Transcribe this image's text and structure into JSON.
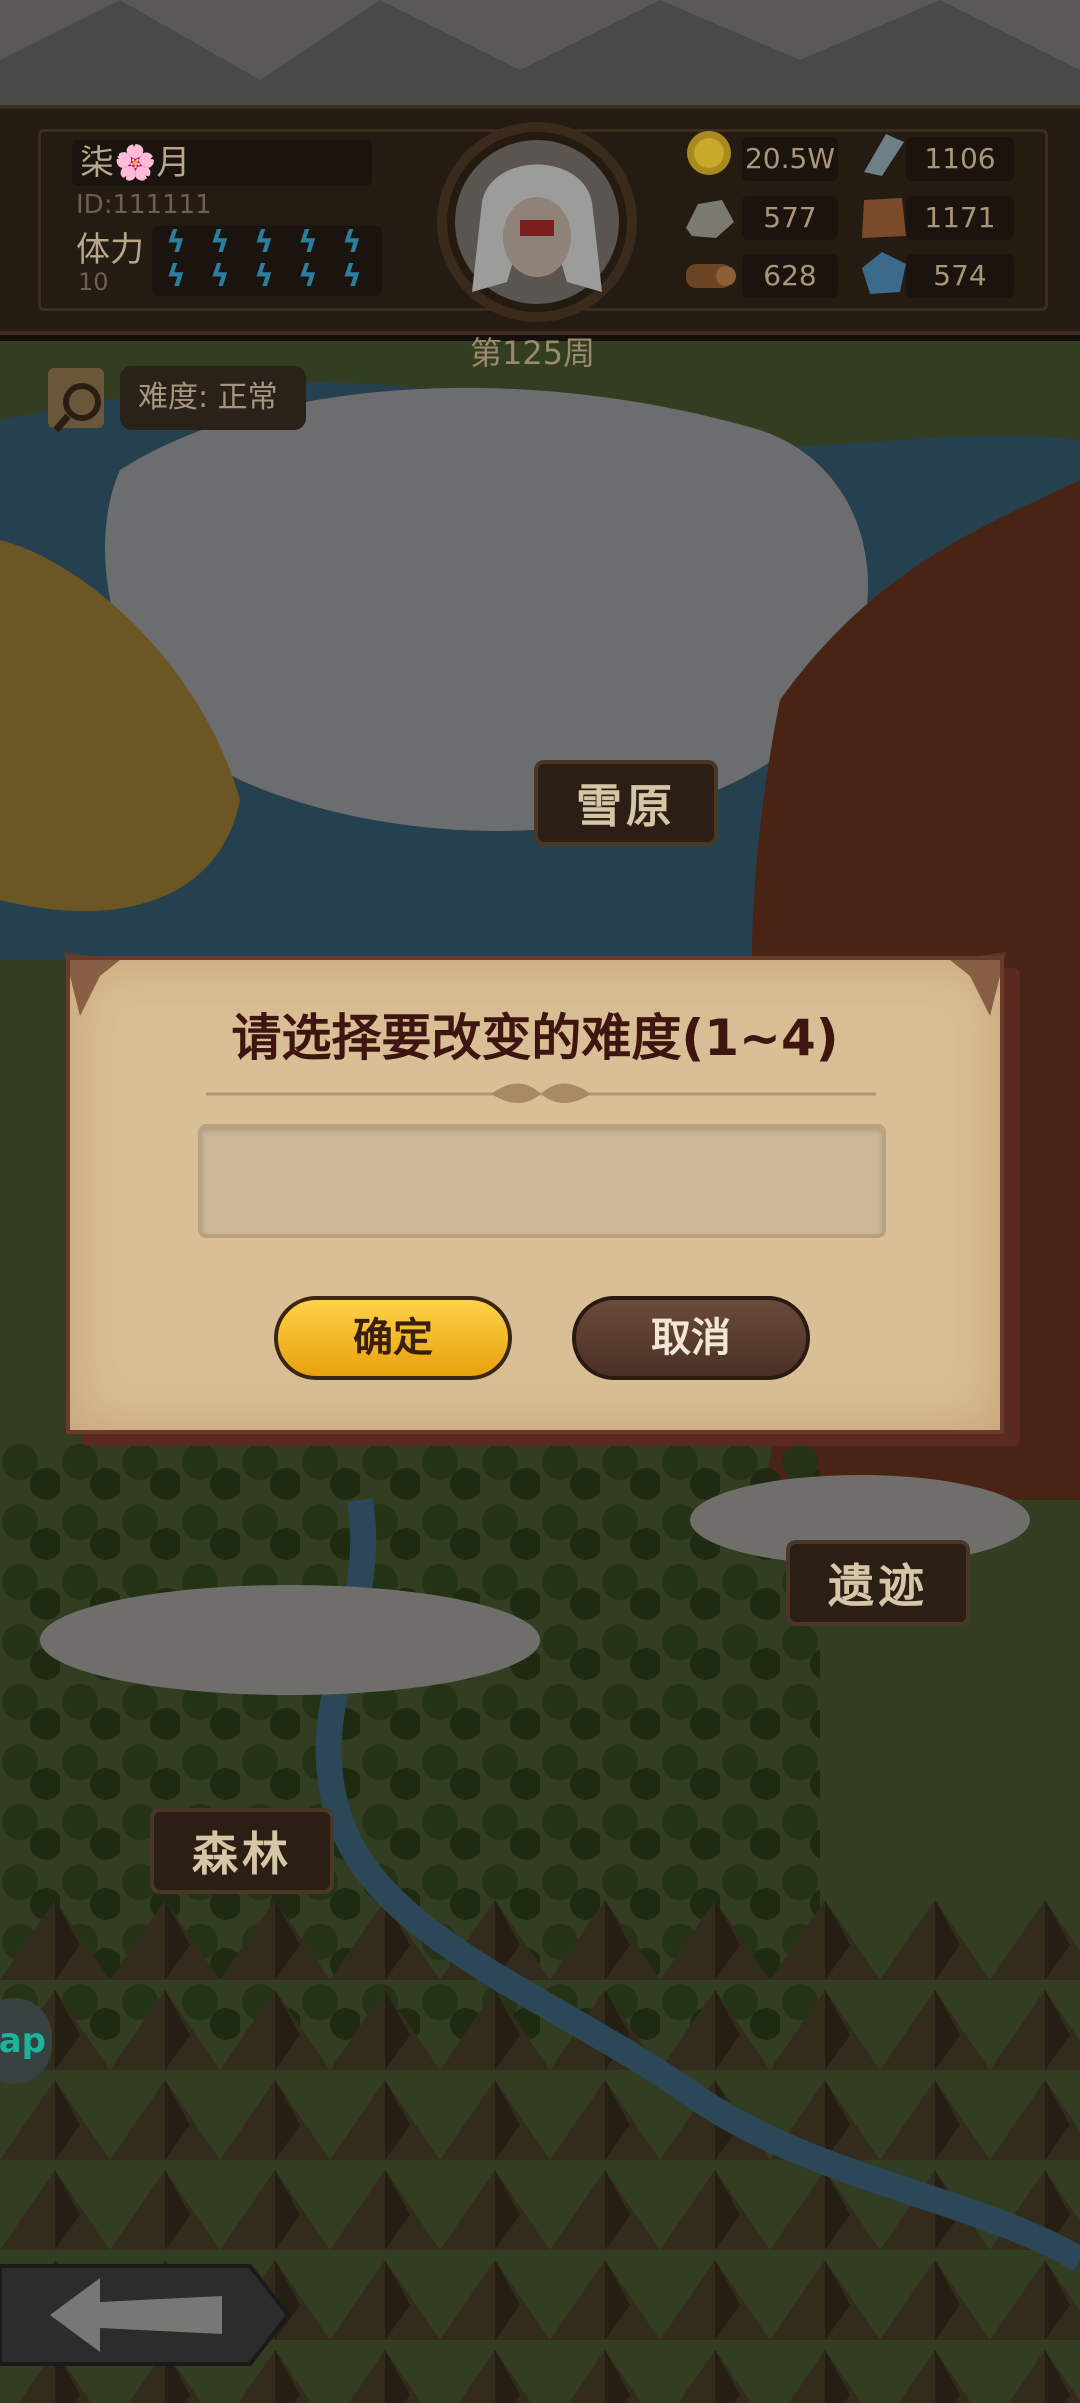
{
  "player": {
    "name": "柒🌸月",
    "id_text": "ID:111111",
    "stamina_label": "体力",
    "stamina_value": "10",
    "stamina_bolts": 10
  },
  "week_label": "第125周",
  "resources": [
    {
      "icon": "gold-coin-icon",
      "value": "20.5W"
    },
    {
      "icon": "crystal-shard-icon",
      "value": "1106"
    },
    {
      "icon": "stone-ore-icon",
      "value": "577"
    },
    {
      "icon": "leather-hide-icon",
      "value": "1171"
    },
    {
      "icon": "wood-log-icon",
      "value": "628"
    },
    {
      "icon": "blue-gem-icon",
      "value": "574"
    }
  ],
  "difficulty": {
    "label": "难度: 正常"
  },
  "regions": [
    {
      "name": "雪原"
    },
    {
      "name": "遗迹"
    },
    {
      "name": "森林"
    }
  ],
  "dialog": {
    "title": "请选择要改变的难度(1~4)",
    "input_value": "",
    "confirm_label": "确定",
    "cancel_label": "取消"
  },
  "side_badge": "ap",
  "colors": {
    "gold_button": "#f2b81c",
    "cancel_button": "#5a3c2e",
    "dialog_bg": "#d9bf95",
    "title_text": "#3e1510"
  }
}
